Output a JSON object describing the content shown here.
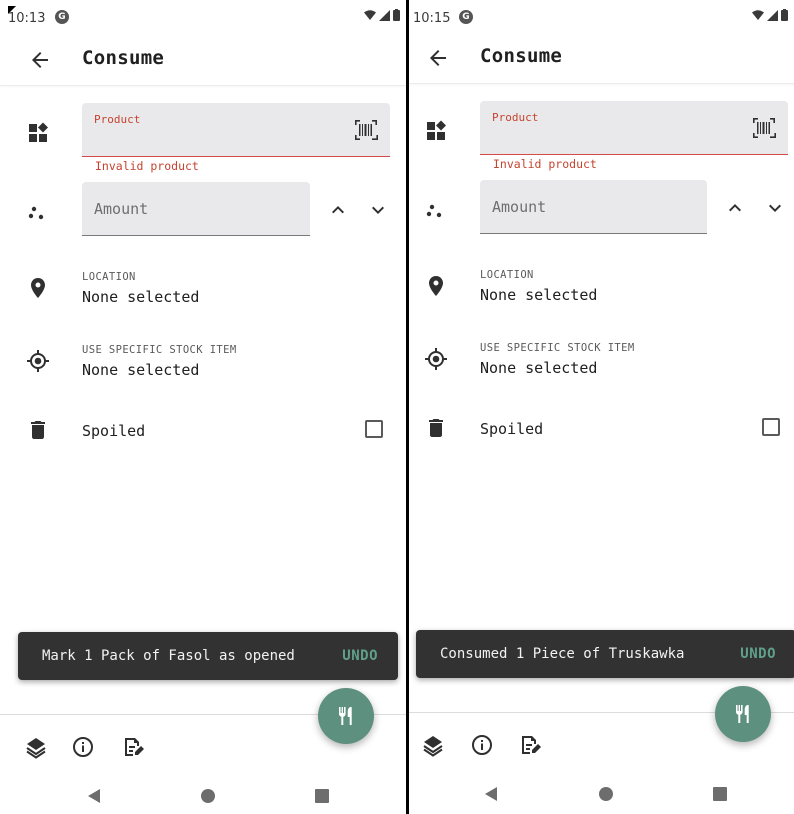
{
  "screens": [
    {
      "status_time": "10:13",
      "status_app_initial": "G",
      "title": "Consume",
      "product_label": "Product",
      "product_error": "Invalid product",
      "amount_placeholder": "Amount",
      "location_overline": "LOCATION",
      "location_value": "None selected",
      "stock_overline": "USE SPECIFIC STOCK ITEM",
      "stock_value": "None selected",
      "spoiled_label": "Spoiled",
      "snackbar_text": "Mark 1 Pack of Fasol as opened",
      "snackbar_action": "UNDO"
    },
    {
      "status_time": "10:15",
      "status_app_initial": "G",
      "title": "Consume",
      "product_label": "Product",
      "product_error": "Invalid product",
      "amount_placeholder": "Amount",
      "location_overline": "LOCATION",
      "location_value": "None selected",
      "stock_overline": "USE SPECIFIC STOCK ITEM",
      "stock_value": "None selected",
      "spoiled_label": "Spoiled",
      "snackbar_text": "Consumed 1 Piece of Truskawka",
      "snackbar_action": "UNDO"
    }
  ],
  "icons": {
    "back": "arrow-left-icon",
    "product": "category-grid-icon",
    "barcode": "barcode-scan-icon",
    "amount": "scatter-dots-icon",
    "increase": "chevron-up-icon",
    "decrease": "chevron-down-icon",
    "location": "map-pin-icon",
    "stock_item": "target-crosshair-icon",
    "spoiled": "trash-icon",
    "bottom_layers": "layers-icon",
    "bottom_info": "info-icon",
    "bottom_doc": "document-edit-icon",
    "fab": "fork-knife-icon"
  },
  "colors": {
    "error": "#c6442f",
    "accent": "#5e9080",
    "snackbar_bg": "#323232",
    "snackbar_action": "#5fa08a",
    "field_bg": "#e9e9eb"
  }
}
